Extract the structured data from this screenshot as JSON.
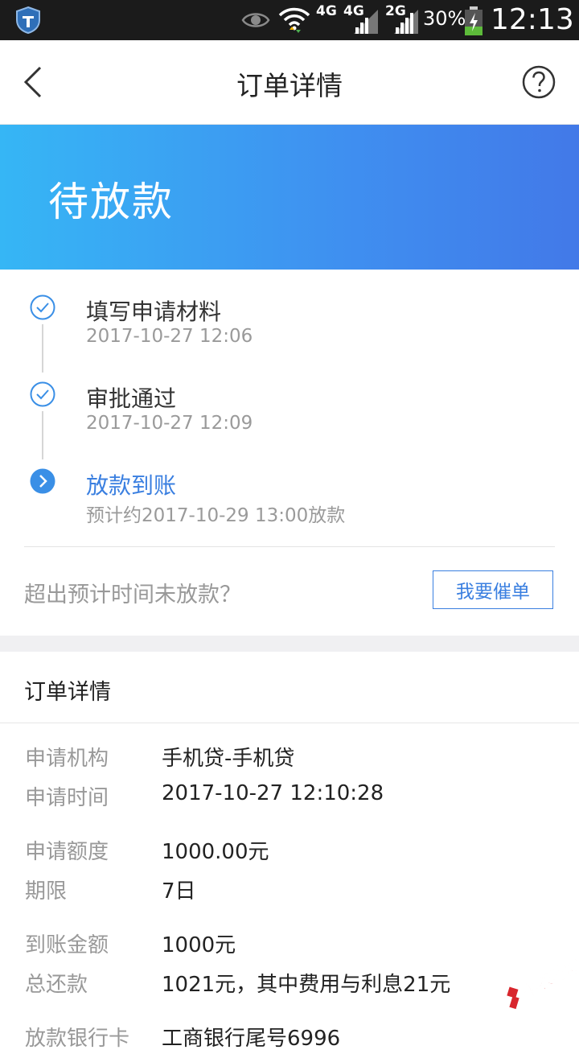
{
  "status_bar": {
    "net1": "4G",
    "net2": "4G",
    "net3": "2G",
    "battery": "30%",
    "time": "12:13"
  },
  "nav": {
    "title": "订单详情"
  },
  "banner": {
    "status": "待放款"
  },
  "progress": {
    "steps": [
      {
        "label": "填写申请材料",
        "time": "2017-10-27 12:06",
        "state": "done"
      },
      {
        "label": "审批通过",
        "time": "2017-10-27 12:09",
        "state": "done"
      },
      {
        "label": "放款到账",
        "time": "预计约2017-10-29 13:00放款",
        "state": "current"
      }
    ],
    "remind_question": "超出预计时间未放款？",
    "remind_button": "我要催单"
  },
  "details": {
    "title": "订单详情",
    "rows": [
      {
        "key": "申请机构",
        "value": "手机贷-手机贷"
      },
      {
        "key": "申请时间",
        "value": "2017-10-27 12:10:28"
      },
      {
        "key": "申请额度",
        "value": "1000.00元"
      },
      {
        "key": "期限",
        "value": "7日"
      },
      {
        "key": "到账金额",
        "value": "1000元"
      },
      {
        "key": "总还款",
        "value": "1021元，其中费用与利息21元"
      },
      {
        "key": "放款银行卡",
        "value": "工商银行尾号6996"
      }
    ]
  },
  "watermark": "卡农社区",
  "colors": {
    "accent": "#3a7fe0",
    "banner_start": "#36b6f5",
    "banner_end": "#4279e8"
  }
}
